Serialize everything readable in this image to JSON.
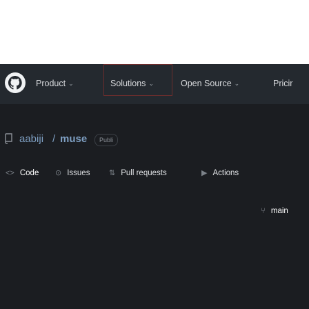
{
  "header": {
    "nav": [
      {
        "label": "Product",
        "has_dropdown": true
      },
      {
        "label": "Solutions",
        "has_dropdown": true
      },
      {
        "label": "Open Source",
        "has_dropdown": true
      },
      {
        "label": "Pricir",
        "has_dropdown": false
      }
    ]
  },
  "repo": {
    "icon": "repo-icon",
    "owner": "aabiji",
    "separator": "/",
    "name": "muse",
    "visibility": "Publi"
  },
  "tabs": [
    {
      "icon": "code-icon",
      "label": "Code",
      "glyph": "<>"
    },
    {
      "icon": "issues-icon",
      "label": "Issues",
      "glyph": "⊙"
    },
    {
      "icon": "pull-request-icon",
      "label": "Pull requests",
      "glyph": "⇅"
    },
    {
      "icon": "actions-icon",
      "label": "Actions",
      "glyph": "▶"
    }
  ],
  "branch": {
    "icon": "branch-icon",
    "label": "main",
    "glyph": "⑂"
  },
  "colors": {
    "header_bg": "#24292f",
    "page_bg": "#1b1d21",
    "link": "#7e9fc2"
  }
}
